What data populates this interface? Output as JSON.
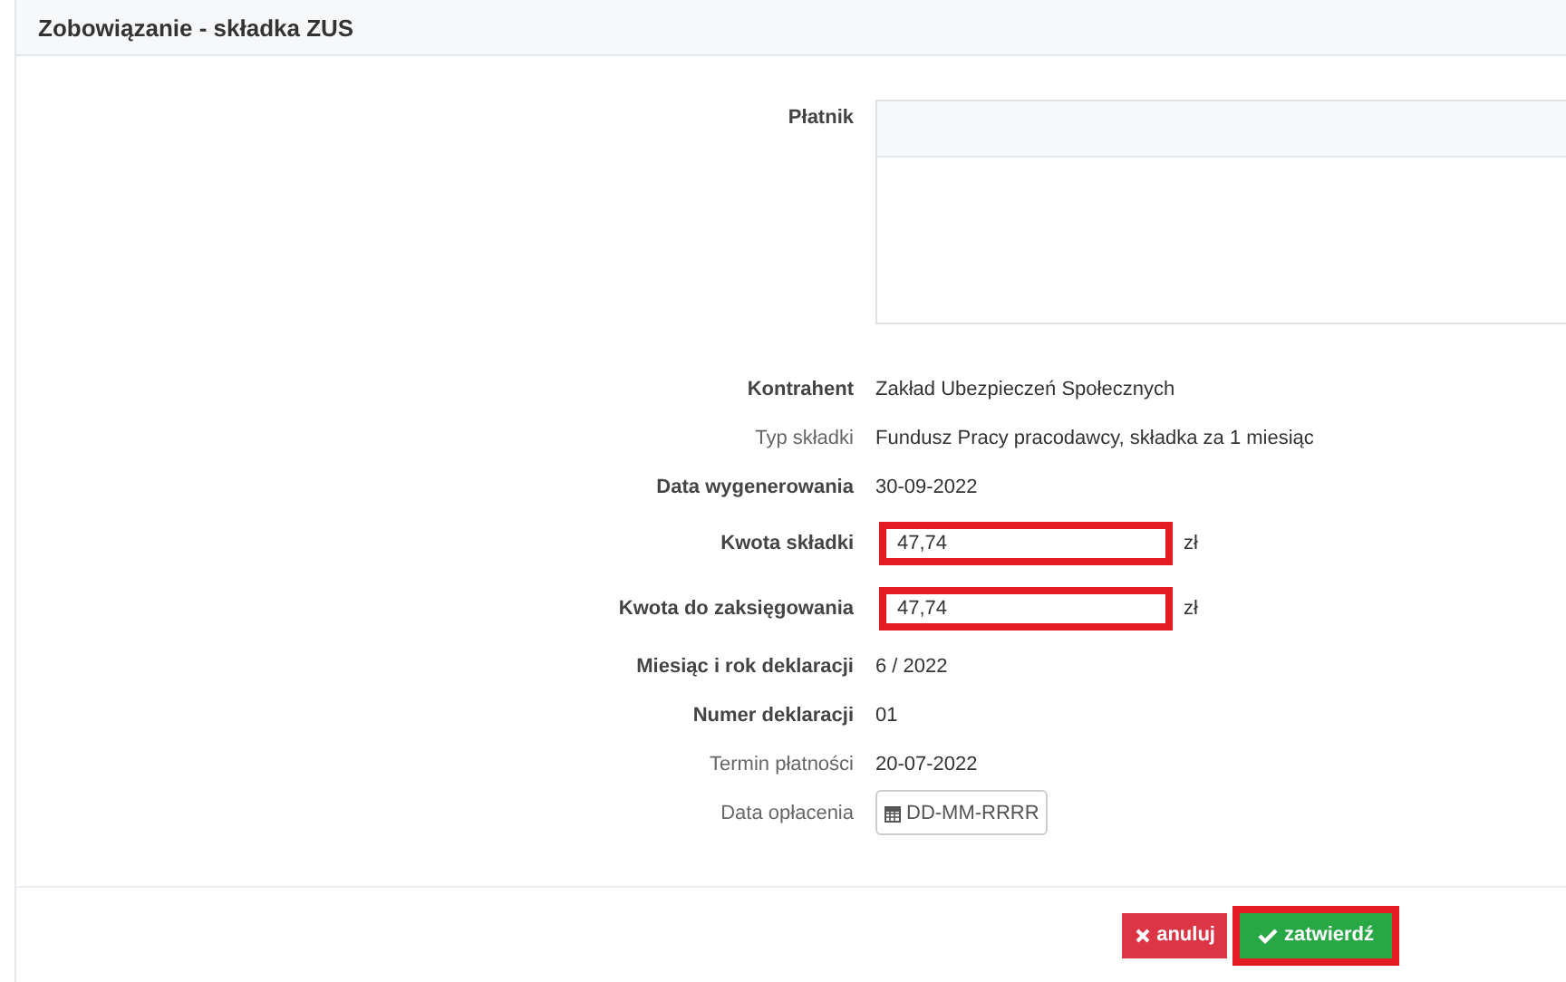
{
  "panel": {
    "title": "Zobowiązanie - składka ZUS"
  },
  "payer": {
    "label": "Płatnik"
  },
  "fields": [
    {
      "kind": "text",
      "label": "Kontrahent",
      "bold": true,
      "value": "Zakład Ubezpieczeń Społecznych"
    },
    {
      "kind": "text",
      "label": "Typ składki",
      "bold": false,
      "value": "Fundusz Pracy pracodawcy, składka za 1 miesiąc"
    },
    {
      "kind": "text",
      "label": "Data wygenerowania",
      "bold": true,
      "value": "30-09-2022"
    },
    {
      "kind": "input",
      "label": "Kwota składki",
      "bold": true,
      "value": "47,74",
      "unit": "zł",
      "highlighted": true
    },
    {
      "kind": "input",
      "label": "Kwota do zaksięgowania",
      "bold": true,
      "value": "47,74",
      "unit": "zł",
      "highlighted": true
    },
    {
      "kind": "text",
      "label": "Miesiąc i rok deklaracji",
      "bold": true,
      "value": "6 / 2022"
    },
    {
      "kind": "text",
      "label": "Numer deklaracji",
      "bold": true,
      "value": "01"
    },
    {
      "kind": "text",
      "label": "Termin płatności",
      "bold": false,
      "value": "20-07-2022"
    },
    {
      "kind": "date",
      "label": "Data opłacenia",
      "bold": false,
      "placeholder": "DD-MM-RRRR"
    }
  ],
  "buttons": [
    {
      "kind": "cancel",
      "label": "anuluj",
      "highlighted": false
    },
    {
      "kind": "confirm",
      "label": "zatwierdź",
      "highlighted": true
    }
  ]
}
